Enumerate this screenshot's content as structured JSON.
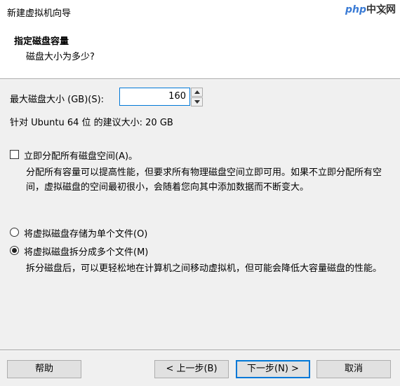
{
  "window": {
    "title": "新建虚拟机向导",
    "watermark_a": "php",
    "watermark_b": "中文网"
  },
  "header": {
    "title": "指定磁盘容量",
    "subtitle": "磁盘大小为多少?"
  },
  "disk_size": {
    "label": "最大磁盘大小 (GB)(S):",
    "value": "160",
    "recommended": "针对 Ubuntu 64 位 的建议大小: 20 GB"
  },
  "allocate": {
    "label": "立即分配所有磁盘空间(A)。",
    "checked": false,
    "description": "分配所有容量可以提高性能，但要求所有物理磁盘空间立即可用。如果不立即分配所有空间，虚拟磁盘的空间最初很小，会随着您向其中添加数据而不断变大。"
  },
  "storage": {
    "single_label": "将虚拟磁盘存储为单个文件(O)",
    "split_label": "将虚拟磁盘拆分成多个文件(M)",
    "selected": "split",
    "split_description": "拆分磁盘后，可以更轻松地在计算机之间移动虚拟机，但可能会降低大容量磁盘的性能。"
  },
  "footer": {
    "help": "帮助",
    "back": "< 上一步(B)",
    "next": "下一步(N) >",
    "cancel": "取消"
  }
}
